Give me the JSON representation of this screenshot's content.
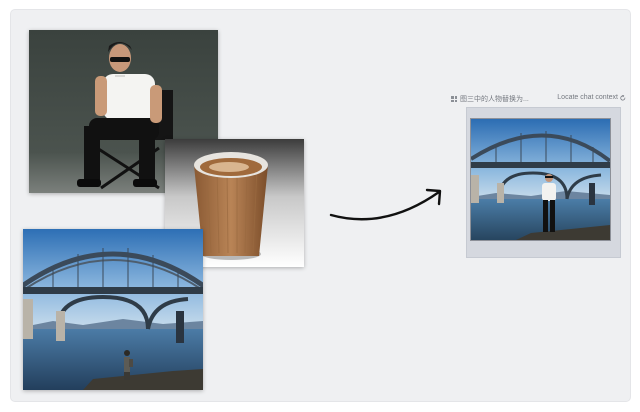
{
  "inputs": [
    {
      "name": "man-sunglasses-photo"
    },
    {
      "name": "coffee-cup-photo"
    },
    {
      "name": "bridge-person-photo"
    }
  ],
  "result": {
    "title": "图三中的人物替换为...",
    "locate_label": "Locate chat context"
  },
  "colors": {
    "canvas": "#eff0f2",
    "frame": "#d5d8df",
    "text_muted": "#757980"
  }
}
